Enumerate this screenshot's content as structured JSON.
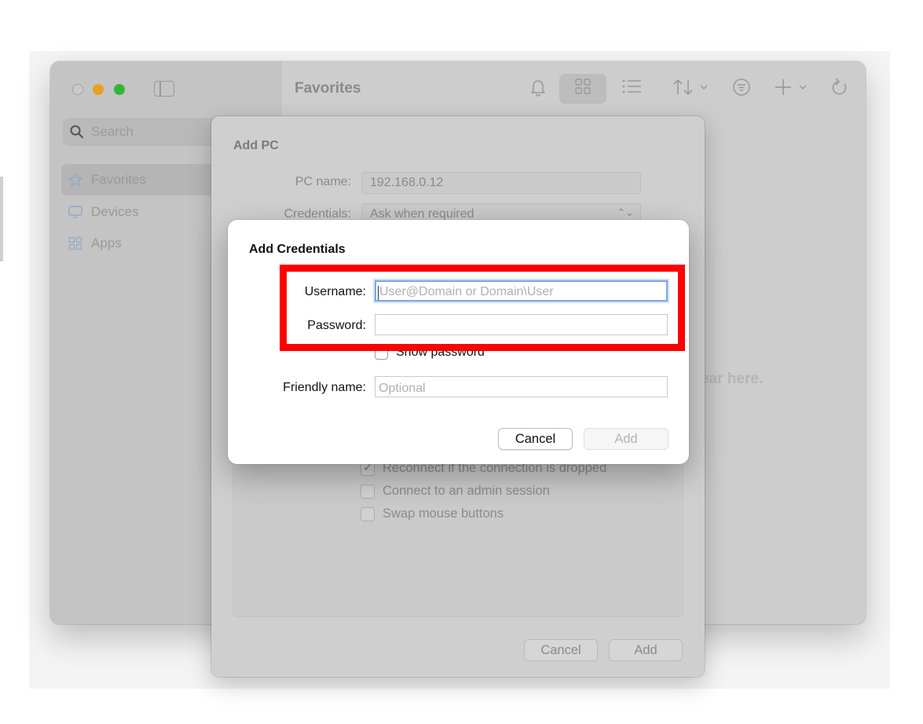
{
  "window": {
    "title": "Favorites",
    "sidebar": {
      "search_placeholder": "Search",
      "items": [
        {
          "label": "Favorites",
          "icon": "star-icon",
          "selected": true
        },
        {
          "label": "Devices",
          "icon": "monitor-icon",
          "selected": false
        },
        {
          "label": "Apps",
          "icon": "apps-icon",
          "selected": false
        }
      ]
    },
    "toolbar": {
      "icons": [
        "bell-icon",
        "grid-view-icon",
        "list-view-icon",
        "sort-icon",
        "filter-icon",
        "add-icon",
        "refresh-icon"
      ]
    },
    "empty_state_text": "ear here."
  },
  "add_pc_sheet": {
    "title": "Add PC",
    "pc_name_label": "PC name:",
    "pc_name_value": "192.168.0.12",
    "credentials_label": "Credentials:",
    "credentials_value": "Ask when required",
    "options": [
      {
        "label": "Reconnect if the connection is dropped",
        "checked": true
      },
      {
        "label": "Connect to an admin session",
        "checked": false
      },
      {
        "label": "Swap mouse buttons",
        "checked": false
      }
    ],
    "cancel_label": "Cancel",
    "add_label": "Add"
  },
  "credentials_dialog": {
    "title": "Add Credentials",
    "username_label": "Username:",
    "username_placeholder": "User@Domain or Domain\\User",
    "username_value": "",
    "password_label": "Password:",
    "password_value": "",
    "show_password_label": "Show password",
    "show_password_checked": false,
    "friendly_name_label": "Friendly name:",
    "friendly_name_placeholder": "Optional",
    "cancel_label": "Cancel",
    "add_label": "Add",
    "add_enabled": false
  },
  "highlight_color": "#ff0000"
}
